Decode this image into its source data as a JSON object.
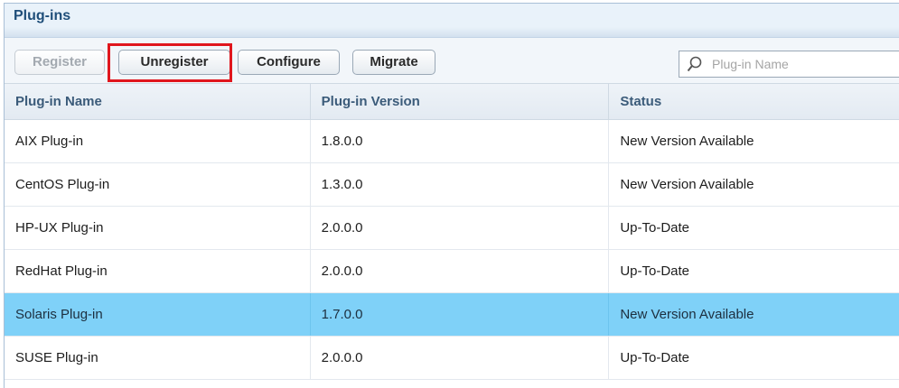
{
  "panel": {
    "title": "Plug-ins"
  },
  "toolbar": {
    "register_label": "Register",
    "unregister_label": "Unregister",
    "configure_label": "Configure",
    "migrate_label": "Migrate",
    "search_placeholder": "Plug-in Name"
  },
  "table": {
    "headers": [
      "Plug-in Name",
      "Plug-in Version",
      "Status"
    ],
    "rows": [
      {
        "name": "AIX Plug-in",
        "version": "1.8.0.0",
        "status": "New Version Available",
        "selected": false
      },
      {
        "name": "CentOS Plug-in",
        "version": "1.3.0.0",
        "status": "New Version Available",
        "selected": false
      },
      {
        "name": "HP-UX Plug-in",
        "version": "2.0.0.0",
        "status": "Up-To-Date",
        "selected": false
      },
      {
        "name": "RedHat Plug-in",
        "version": "2.0.0.0",
        "status": "Up-To-Date",
        "selected": false
      },
      {
        "name": "Solaris Plug-in",
        "version": "1.7.0.0",
        "status": "New Version Available",
        "selected": true
      },
      {
        "name": "SUSE Plug-in",
        "version": "2.0.0.0",
        "status": "Up-To-Date",
        "selected": false
      }
    ]
  },
  "icons": {
    "search": "search-icon",
    "annotation": "red-arrow-annotation"
  },
  "colors": {
    "title": "#1f4e79",
    "header_text": "#3b5b7a",
    "selected_row": "#7fd1f8",
    "annotation": "#e0161d"
  }
}
